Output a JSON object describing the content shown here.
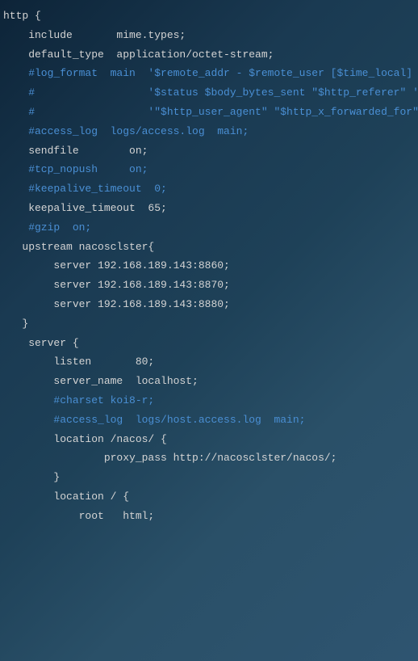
{
  "lines": [
    {
      "text": "http {",
      "cls": "kw"
    },
    {
      "text": "    include       mime.types;",
      "cls": "kw"
    },
    {
      "text": "    default_type  application/octet-stream;",
      "cls": "kw"
    },
    {
      "text": "",
      "cls": "kw"
    },
    {
      "text": "    #log_format  main  '$remote_addr - $remote_user [$time_local] \"$",
      "cls": "cm"
    },
    {
      "text": "    #                  '$status $body_bytes_sent \"$http_referer\" '",
      "cls": "cm"
    },
    {
      "text": "    #                  '\"$http_user_agent\" \"$http_x_forwarded_for\"';",
      "cls": "cm"
    },
    {
      "text": "",
      "cls": "kw"
    },
    {
      "text": "    #access_log  logs/access.log  main;",
      "cls": "cm"
    },
    {
      "text": "",
      "cls": "kw"
    },
    {
      "text": "    sendfile        on;",
      "cls": "kw"
    },
    {
      "text": "    #tcp_nopush     on;",
      "cls": "cm"
    },
    {
      "text": "",
      "cls": "kw"
    },
    {
      "text": "    #keepalive_timeout  0;",
      "cls": "cm"
    },
    {
      "text": "    keepalive_timeout  65;",
      "cls": "kw"
    },
    {
      "text": "",
      "cls": "kw"
    },
    {
      "text": "    #gzip  on;",
      "cls": "cm"
    },
    {
      "text": "   upstream nacosclster{",
      "cls": "kw"
    },
    {
      "text": "        server 192.168.189.143:8860;",
      "cls": "kw"
    },
    {
      "text": "        server 192.168.189.143:8870;",
      "cls": "kw"
    },
    {
      "text": "        server 192.168.189.143:8880;",
      "cls": "kw"
    },
    {
      "text": "   }",
      "cls": "kw"
    },
    {
      "text": "    server {",
      "cls": "kw"
    },
    {
      "text": "        listen       80;",
      "cls": "kw"
    },
    {
      "text": "        server_name  localhost;",
      "cls": "kw"
    },
    {
      "text": "",
      "cls": "kw"
    },
    {
      "text": "        #charset koi8-r;",
      "cls": "cm"
    },
    {
      "text": "",
      "cls": "kw"
    },
    {
      "text": "        #access_log  logs/host.access.log  main;",
      "cls": "cm"
    },
    {
      "text": "        location /nacos/ {",
      "cls": "kw"
    },
    {
      "text": "                proxy_pass http://nacosclster/nacos/;",
      "cls": "kw"
    },
    {
      "text": "        }",
      "cls": "kw"
    },
    {
      "text": "        location / {",
      "cls": "kw"
    },
    {
      "text": "            root   html;",
      "cls": "kw"
    }
  ]
}
